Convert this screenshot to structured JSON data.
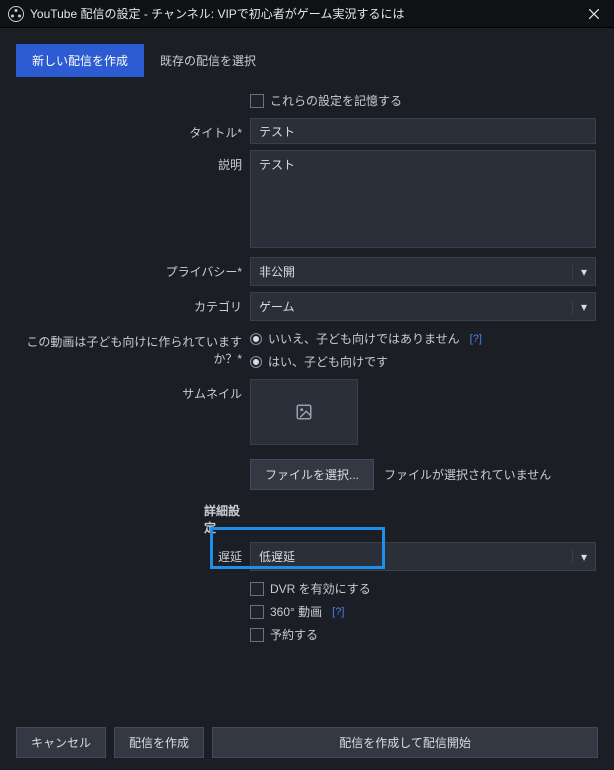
{
  "window": {
    "title": "YouTube 配信の設定 - チャンネル: VIPで初心者がゲーム実況するには"
  },
  "tabs": {
    "new": "新しい配信を作成",
    "existing": "既存の配信を選択"
  },
  "remember": {
    "label": "これらの設定を記憶する"
  },
  "titleField": {
    "label": "タイトル*",
    "value": "テスト"
  },
  "descField": {
    "label": "説明",
    "value": "テスト"
  },
  "privacy": {
    "label": "プライバシー*",
    "value": "非公開"
  },
  "category": {
    "label": "カテゴリ",
    "value": "ゲーム"
  },
  "kids": {
    "label": "この動画は子ども向けに作られていますか？*",
    "no": "いいえ、子ども向けではありません",
    "yes": "はい、子ども向けです",
    "help": "[?]"
  },
  "thumbnail": {
    "label": "サムネイル",
    "select": "ファイルを選択...",
    "none": "ファイルが選択されていません"
  },
  "advanced": {
    "title": "詳細設定",
    "latency_label": "遅延",
    "latency_value": "低遅延",
    "dvr": "DVR を有効にする",
    "v360": "360° 動画",
    "v360_help": "[?]",
    "schedule": "予約する"
  },
  "footer": {
    "cancel": "キャンセル",
    "create": "配信を作成",
    "start": "配信を作成して配信開始"
  }
}
